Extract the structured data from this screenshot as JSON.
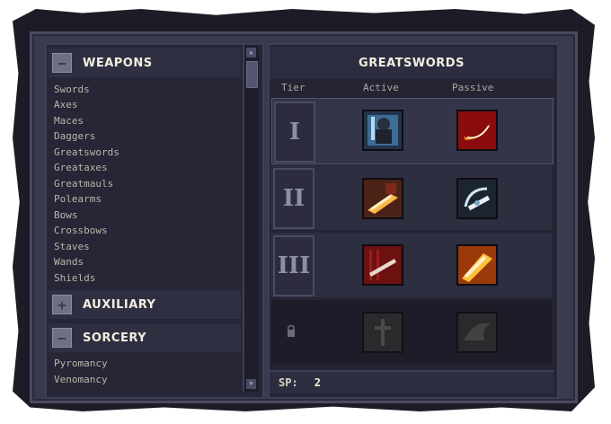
{
  "sidebar": {
    "weapons": {
      "label": "WEAPONS",
      "toggle": "−",
      "items": [
        "Swords",
        "Axes",
        "Maces",
        "Daggers",
        "Greatswords",
        "Greataxes",
        "Greatmauls",
        "Polearms",
        "Bows",
        "Crossbows",
        "Staves",
        "Wands",
        "Shields"
      ]
    },
    "auxiliary": {
      "label": "AUXILIARY",
      "toggle": "+"
    },
    "sorcery": {
      "label": "SORCERY",
      "toggle": "−",
      "items": [
        "Pyromancy",
        "Venomancy"
      ]
    }
  },
  "panel": {
    "title": "GREATSWORDS",
    "columns": {
      "tier": "Tier",
      "active": "Active",
      "passive": "Passive"
    },
    "tiers": [
      {
        "numeral": "I",
        "active_icon": "armored-knight-icon",
        "passive_icon": "crescent-slash-icon",
        "state": "selected"
      },
      {
        "numeral": "II",
        "active_icon": "flaming-sword-thrust-icon",
        "passive_icon": "spinning-blade-icon",
        "state": "unlocked"
      },
      {
        "numeral": "III",
        "active_icon": "blood-blade-icon",
        "passive_icon": "fire-blade-icon",
        "state": "unlocked"
      },
      {
        "numeral": "",
        "active_icon": "locked-sword-icon",
        "passive_icon": "locked-wing-icon",
        "state": "locked"
      }
    ],
    "sp_label": "SP:",
    "sp_value": "2"
  },
  "colors": {
    "background": "#1d1b26",
    "panel": "#262636",
    "text_light": "#f2eedf",
    "text_muted": "#b7b7ac"
  }
}
